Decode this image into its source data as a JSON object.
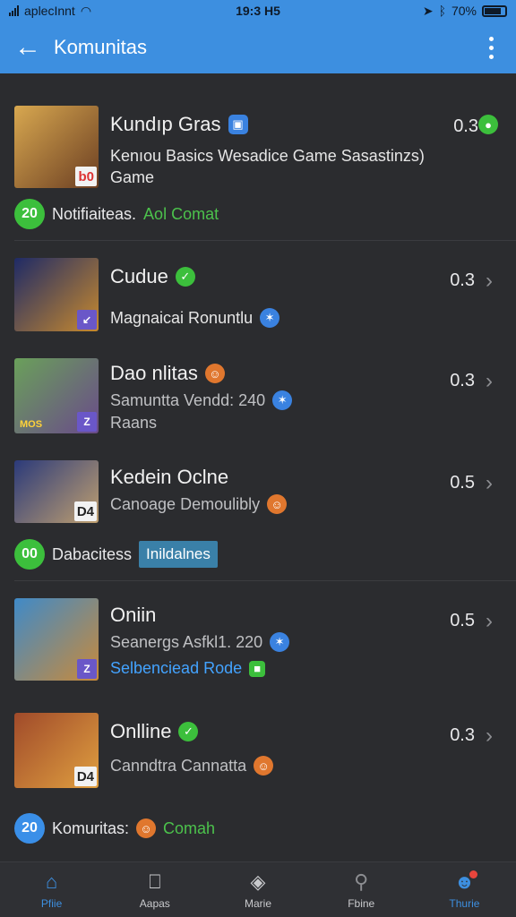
{
  "status": {
    "carrier": "aplecInnt",
    "time": "19:3 H5",
    "battery": "70%"
  },
  "appbar": {
    "title": "Komunitas"
  },
  "items": [
    {
      "name": "Kundıp Gras",
      "sub": "Kenıou Basics Wesadice Game Sasastinzs) Game",
      "score": "0.3",
      "badge": "b0",
      "colors": [
        "#c89a45",
        "#7a4a2a"
      ]
    },
    {
      "name": "Cudue",
      "sub": "Magnaicai Ronuntlu",
      "score": "0.3",
      "badge": "↙",
      "colors": [
        "#2a2a6a",
        "#d89a30"
      ]
    },
    {
      "name": "Dao nlitas",
      "sub": "Samuntta Vendd: 240",
      "sub2": "Raans",
      "score": "0.3",
      "badge": "Z",
      "badge_text": "MOS",
      "colors": [
        "#4f8a4a",
        "#6b5a9a"
      ]
    },
    {
      "name": "Kedein Oclne",
      "sub": "Canoage Demoulibly",
      "score": "0.5",
      "badge": "D4",
      "colors": [
        "#2b3a7a",
        "#c0a070"
      ]
    },
    {
      "name": "Oniin",
      "sub": "Seanergs Asfkl1. 220",
      "sub2": "Selbenciead Rode",
      "score": "0.5",
      "badge": "Z",
      "colors": [
        "#3f8ac8",
        "#c98a3a"
      ]
    },
    {
      "name": "Onlline",
      "sub": "Canndtra Cannatta",
      "score": "0.3",
      "badge": "D4",
      "colors": [
        "#a04a2a",
        "#e0a040"
      ]
    }
  ],
  "notices": [
    {
      "count": "20",
      "label": "Notifiaiteas.",
      "link": "Aol Comat"
    },
    {
      "count": "00",
      "label": "Dabacitess",
      "tag": "Inildalnes"
    },
    {
      "count": "20",
      "label": "Komuritas:",
      "link": "Comah"
    }
  ],
  "tabs": [
    {
      "label": "Pfiie"
    },
    {
      "label": "Aapas"
    },
    {
      "label": "Marie"
    },
    {
      "label": "Fbine"
    },
    {
      "label": "Thurie"
    }
  ]
}
